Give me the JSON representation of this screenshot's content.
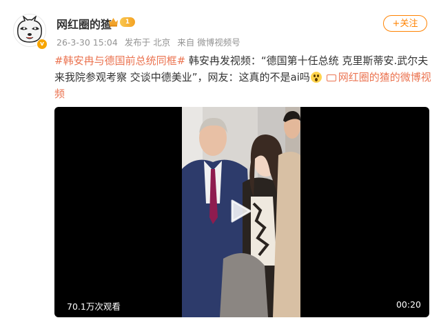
{
  "author": {
    "name": "网红圈的猹",
    "level": "1",
    "date": "26-3-30 15:04",
    "location": "发布于 北京",
    "source": "来自 微博视频号"
  },
  "follow_label": "+关注",
  "post": {
    "hashtag": "#韩安冉与德国前总统同框#",
    "body": " 韩安冉发视频：“德国第十任总统 克里斯蒂安.武尔夫来我院参观考察 交谈中德美业”，网友：这真的不是ai吗",
    "video_link": "网红圈的猹的微博视频"
  },
  "video": {
    "views": "70.1万次观看",
    "duration": "00:20"
  },
  "colors": {
    "accent": "#eb7350",
    "follow": "#ff8200"
  }
}
